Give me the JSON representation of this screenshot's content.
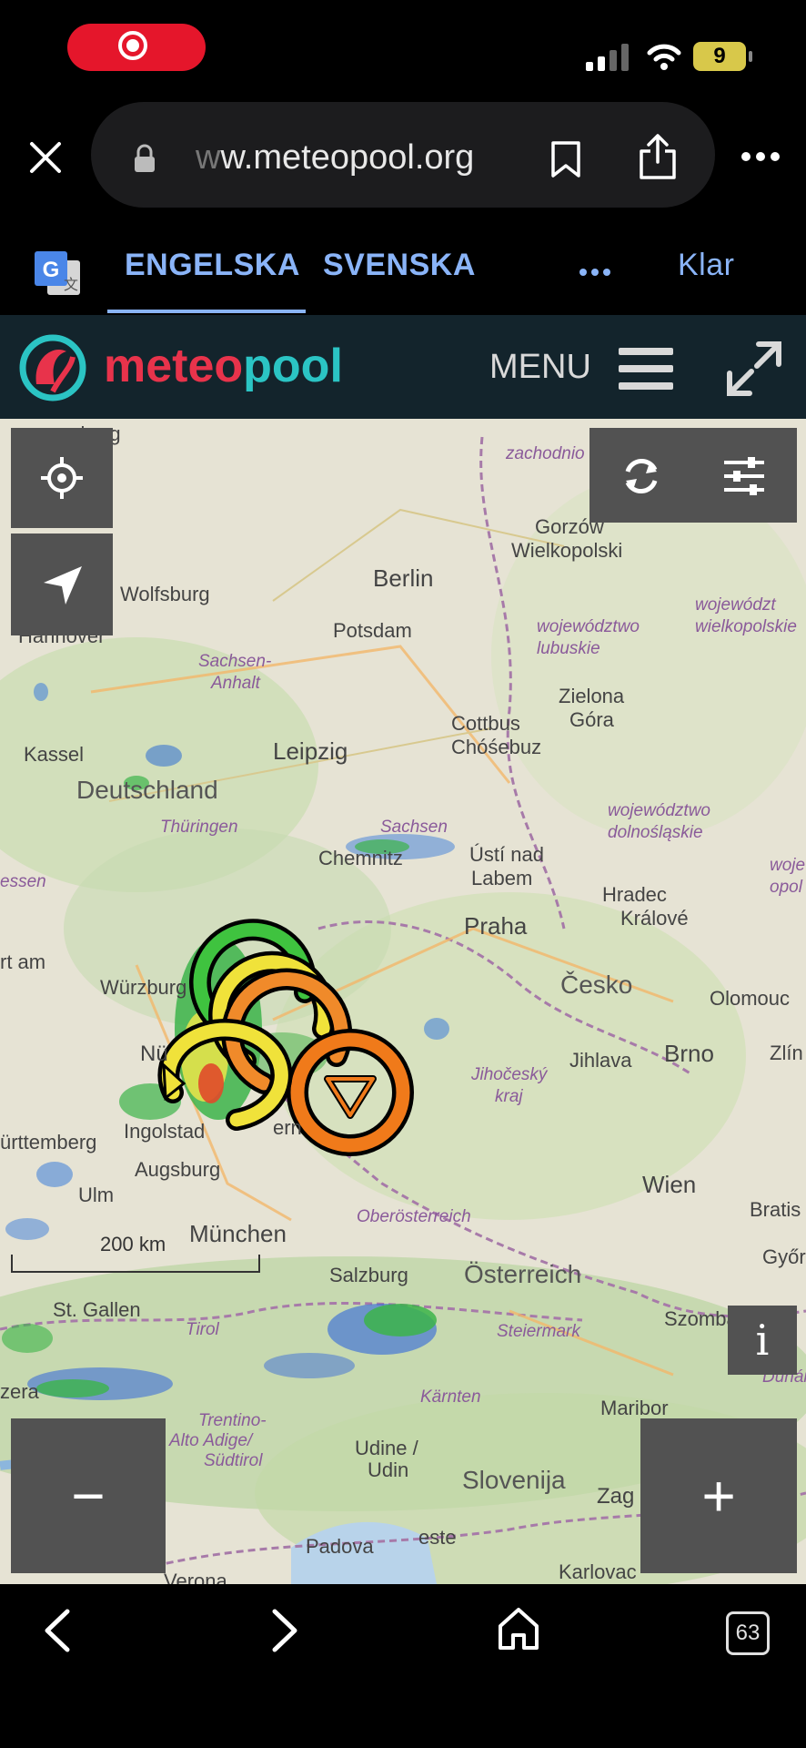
{
  "status_bar": {
    "battery_level": "9"
  },
  "browser": {
    "url_faded": "w",
    "url_main": "w.meteopool.org"
  },
  "translate_bar": {
    "tab_source": "ENGELSKA",
    "tab_target": "SVENSKA",
    "done_label": "Klar"
  },
  "site_header": {
    "brand_part1": "meteo",
    "brand_part2": "pool",
    "menu_label": "MENU"
  },
  "map": {
    "scale_label": "200 km",
    "zoom_out_label": "−",
    "zoom_in_label": "+",
    "info_label": "i",
    "places": {
      "hamburg": "amburg",
      "zachodnio": "zachodnio",
      "gorzow": "Gorzów",
      "wielkopolski": "Wielkopolski",
      "berlin": "Berlin",
      "wolfsburg": "Wolfsburg",
      "hannover": "Hannover",
      "potsdam": "Potsdam",
      "woj_lubuskie_1": "województwo",
      "woj_lubuskie_2": "lubuskie",
      "woj_wlkp_1": "województ",
      "woj_wlkp_2": "wielkopolskie",
      "sachsen_anhalt_1": "Sachsen-",
      "sachsen_anhalt_2": "Anhalt",
      "zielona": "Zielona",
      "gora": "Góra",
      "kassel": "Kassel",
      "leipzig": "Leipzig",
      "cottbus": "Cottbus",
      "chosebuz": "Chóśebuz",
      "deutschland": "Deutschland",
      "woj_dolno_1": "województwo",
      "woj_dolno_2": "dolnośląskie",
      "thuringen": "Thüringen",
      "sachsen": "Sachsen",
      "chemnitz": "Chemnitz",
      "usti_1": "Ústí nad",
      "usti_2": "Labem",
      "hessen": "essen",
      "woj_opol_1": "wojew",
      "woj_opol_2": "opol",
      "hradec_1": "Hradec",
      "hradec_2": "Králové",
      "praha": "Praha",
      "frankfurt": "rt am",
      "wurzburg": "Würzburg",
      "cesko": "Česko",
      "olomouc": "Olomouc",
      "nurnberg": "Nü",
      "jihocesky_1": "Jihočeský",
      "jihocesky_2": "kraj",
      "jihlava": "Jihlava",
      "brno": "Brno",
      "zlin": "Zlín",
      "ingolstadt": "Ingolstad",
      "wurttemberg": "ürttemberg",
      "bern": "ern",
      "augsburg": "Augsburg",
      "ulm": "Ulm",
      "wien": "Wien",
      "bratislava": "Bratis",
      "munchen": "München",
      "oberosterreich": "Oberösterreich",
      "gyor": "Győr",
      "salzburg": "Salzburg",
      "osterreich": "Österreich",
      "st_gallen": "St. Gallen",
      "tirol": "Tirol",
      "steiermark": "Steiermark",
      "szombathely": "Szombath",
      "dunantul": "Dunántúl",
      "zera": "zera",
      "karnten": "Kärnten",
      "maribor": "Maribor",
      "trentino_1": "Trentino-",
      "trentino_2": "Alto Adige/",
      "trentino_3": "Südtirol",
      "udine_1": "Udine /",
      "udine_2": "Udin",
      "slovenija": "Slovenija",
      "zagreb": "Zag",
      "verona": "Verona",
      "padova": "Padova",
      "trieste": "este",
      "karlovac": "Karlovac"
    }
  },
  "bottom_bar": {
    "tabs_count": "63"
  }
}
